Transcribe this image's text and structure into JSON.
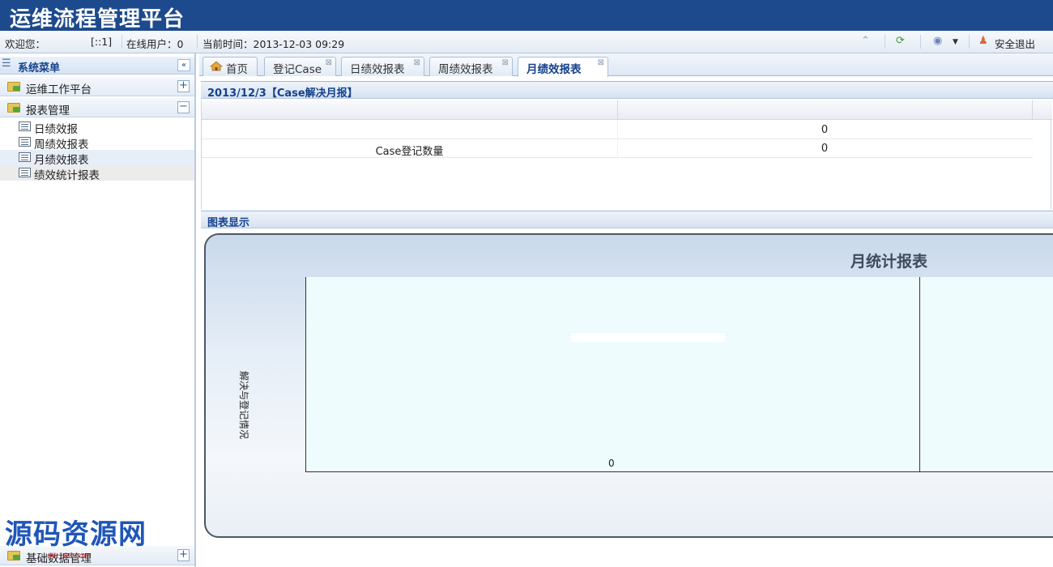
{
  "app": {
    "title": "运维流程管理平台"
  },
  "status": {
    "welcome": "欢迎您：",
    "user_id": "[::1]",
    "online_users": "在线用户：0",
    "current_time": "当前时间：2013-12-03 09:29",
    "logout": "安全退出"
  },
  "sidebar": {
    "title": "系统菜单",
    "groups": [
      {
        "label": "运维工作平台",
        "toggle": "+"
      },
      {
        "label": "报表管理",
        "toggle": "−"
      },
      {
        "label": "基础数据管理",
        "toggle": "+"
      }
    ],
    "report_items": [
      "日绩效报",
      "周绩效报表",
      "月绩效报表",
      "绩效统计报表"
    ]
  },
  "tabs": [
    {
      "label": "首页"
    },
    {
      "label": "登记Case"
    },
    {
      "label": "日绩效报表"
    },
    {
      "label": "周绩效报表"
    },
    {
      "label": "月绩效报表"
    }
  ],
  "report_panel": {
    "title": "2013/12/3【Case解决月报】",
    "rows": [
      {
        "name": "",
        "value": "0"
      },
      {
        "name": "Case登记数量",
        "value": "0"
      }
    ]
  },
  "chart_panel": {
    "title": "图表显示"
  },
  "chart_data": {
    "type": "bar",
    "title": "月统计报表",
    "ylabel": "解决与登记情况",
    "categories": [
      "0"
    ],
    "series": [
      {
        "values": [
          0
        ]
      }
    ]
  },
  "watermark": {
    "text": "源码资源网",
    "url": "net188.com"
  }
}
